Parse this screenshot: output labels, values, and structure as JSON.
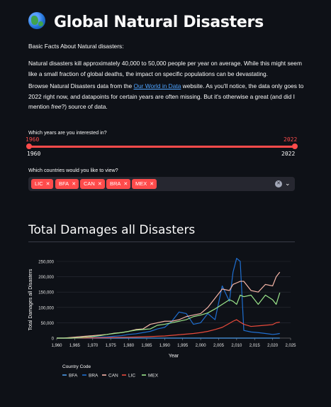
{
  "page": {
    "title": "Global Natural Disasters",
    "intro_heading": "Basic Facts About Natural disasters:",
    "para1": "Natural disasters kill approximately 40,000 to 50,000 people per year on average. While this might seem like a small fraction of global deaths, the impact on specific populations can be devastating.",
    "para2_before": "Browse Natural Disasters data from the ",
    "para2_link": "Our World in Data",
    "para2_mid": " website. As you'll notice, the data only goes to 2022 right now, and datapoints for certain years are often missing. But it's otherwise a great (and did I mention ",
    "para2_em": "free",
    "para2_end": "?) source of data."
  },
  "years_slider": {
    "label": "Which years are you interested in?",
    "min": 1960,
    "max": 2022,
    "low_value": "1960",
    "high_value": "2022",
    "min_label": "1960",
    "max_label": "2022"
  },
  "countries_select": {
    "label": "Which countries would you like to view?",
    "selected": [
      "LIC",
      "BFA",
      "CAN",
      "BRA",
      "MEX"
    ]
  },
  "section_title": "Total Damages all Disasters",
  "colors": {
    "accent": "#ff4b4b"
  },
  "chart_data": {
    "type": "line",
    "xlabel": "Year",
    "ylabel": "Total Damages all Disasters",
    "xlim": [
      1960,
      2025
    ],
    "ylim": [
      0,
      250000
    ],
    "x_ticks": [
      "1,960",
      "1,965",
      "1,970",
      "1,975",
      "1,980",
      "1,985",
      "1,990",
      "1,995",
      "2,000",
      "2,005",
      "2,010",
      "2,015",
      "2,020",
      "2,025"
    ],
    "y_ticks": [
      "0",
      "50,000",
      "100,000",
      "150,000",
      "200,000",
      "250,000"
    ],
    "legend_title": "Country Code",
    "legend_position": "bottom-left",
    "x": [
      1960,
      1962,
      1964,
      1966,
      1968,
      1970,
      1972,
      1974,
      1976,
      1978,
      1980,
      1982,
      1984,
      1986,
      1988,
      1990,
      1992,
      1994,
      1996,
      1998,
      2000,
      2002,
      2004,
      2006,
      2008,
      2009,
      2010,
      2011,
      2012,
      2014,
      2016,
      2018,
      2020,
      2021,
      2022
    ],
    "series": [
      {
        "name": "BFA",
        "color": "#4c9be8",
        "values": [
          0,
          0,
          0,
          0,
          0,
          0,
          0,
          0,
          0,
          0,
          0,
          0,
          0,
          0,
          0,
          0,
          0,
          0,
          0,
          0,
          0,
          0,
          0,
          0,
          0,
          0,
          0,
          0,
          0,
          0,
          0,
          0,
          0,
          0,
          0
        ]
      },
      {
        "name": "BRA",
        "color": "#1f6fd1",
        "values": [
          0,
          0,
          0,
          1000,
          1500,
          2000,
          3000,
          4000,
          6000,
          8000,
          12000,
          14000,
          18000,
          22000,
          30000,
          35000,
          55000,
          85000,
          80000,
          45000,
          50000,
          80000,
          60000,
          170000,
          120000,
          215000,
          260000,
          250000,
          25000,
          20000,
          18000,
          15000,
          12000,
          13000,
          15000
        ]
      },
      {
        "name": "CAN",
        "color": "#f7b6a8",
        "values": [
          0,
          0,
          2000,
          4000,
          6000,
          8000,
          10000,
          12000,
          16000,
          18000,
          22000,
          28000,
          30000,
          45000,
          50000,
          55000,
          55000,
          60000,
          70000,
          75000,
          80000,
          100000,
          130000,
          160000,
          155000,
          175000,
          180000,
          185000,
          185000,
          155000,
          150000,
          175000,
          170000,
          200000,
          215000
        ]
      },
      {
        "name": "LIC",
        "color": "#e84a3b",
        "values": [
          0,
          0,
          0,
          500,
          500,
          800,
          1000,
          1500,
          2000,
          2500,
          3000,
          3500,
          4000,
          5000,
          6000,
          7000,
          9000,
          11000,
          13000,
          15000,
          18000,
          22000,
          28000,
          35000,
          48000,
          55000,
          60000,
          52000,
          45000,
          38000,
          40000,
          42000,
          44000,
          50000,
          52000
        ]
      },
      {
        "name": "MEX",
        "color": "#9be58a",
        "values": [
          0,
          0,
          0,
          1000,
          3000,
          5000,
          8000,
          12000,
          15000,
          18000,
          22000,
          26000,
          28000,
          30000,
          42000,
          45000,
          50000,
          55000,
          60000,
          70000,
          75000,
          82000,
          95000,
          110000,
          125000,
          120000,
          110000,
          140000,
          135000,
          140000,
          110000,
          140000,
          125000,
          110000,
          148000
        ]
      }
    ]
  }
}
